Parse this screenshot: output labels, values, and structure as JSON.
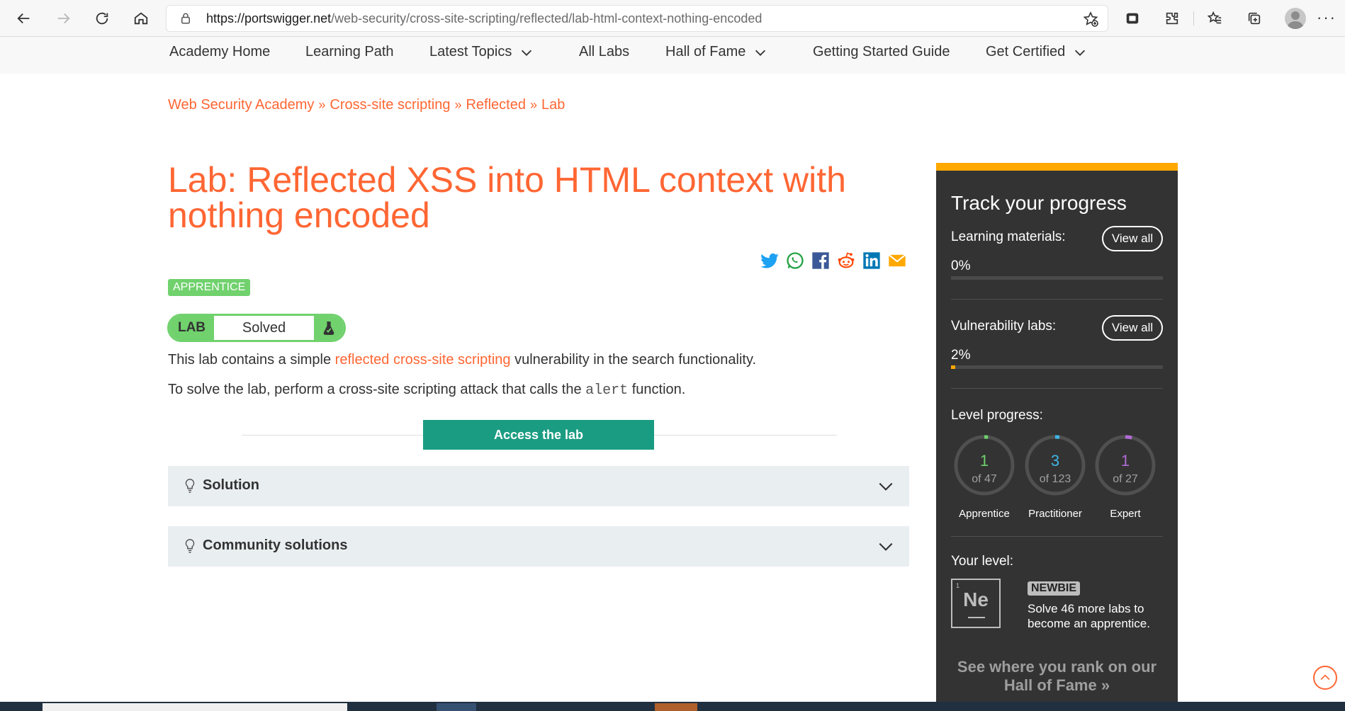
{
  "browser": {
    "url_host": "https://portswigger.net",
    "url_path": "/web-security/cross-site-scripting/reflected/lab-html-context-nothing-encoded",
    "more_label": "···"
  },
  "nav": {
    "items": [
      {
        "label": "Academy Home",
        "dropdown": false
      },
      {
        "label": "Learning Path",
        "dropdown": false
      },
      {
        "label": "Latest Topics",
        "dropdown": true
      },
      {
        "label": "All Labs",
        "dropdown": false
      },
      {
        "label": "Hall of Fame",
        "dropdown": true
      },
      {
        "label": "Getting Started Guide",
        "dropdown": false
      },
      {
        "label": "Get Certified",
        "dropdown": true
      }
    ]
  },
  "breadcrumb": {
    "items": [
      "Web Security Academy",
      "Cross-site scripting",
      "Reflected",
      "Lab"
    ],
    "separator": "»"
  },
  "page": {
    "title": "Lab: Reflected XSS into HTML context with nothing encoded",
    "level_badge": "APPRENTICE",
    "lab_label": "LAB",
    "lab_state": "Solved",
    "para1_pre": "This lab contains a simple ",
    "para1_link": "reflected cross-site scripting",
    "para1_post": " vulnerability in the search functionality.",
    "para2_pre": "To solve the lab, perform a cross-site scripting attack that calls the ",
    "para2_code": "alert",
    "para2_post": " function.",
    "access_button": "Access the lab",
    "accordions": [
      "Solution",
      "Community solutions"
    ],
    "share_icons": [
      "twitter-icon",
      "whatsapp-icon",
      "facebook-icon",
      "reddit-icon",
      "linkedin-icon",
      "email-icon"
    ]
  },
  "sidebar": {
    "title": "Track your progress",
    "learning_label": "Learning materials:",
    "learning_viewall": "View all",
    "learning_pct": "0%",
    "learning_fraction": 0,
    "vuln_label": "Vulnerability labs:",
    "vuln_viewall": "View all",
    "vuln_pct": "2%",
    "vuln_fraction": 0.02,
    "level_progress_label": "Level progress:",
    "levels": [
      {
        "name": "Apprentice",
        "solved": "1",
        "of": "of 47",
        "color": "#70d16d",
        "fraction": 0.021
      },
      {
        "name": "Practitioner",
        "solved": "3",
        "of": "of 123",
        "color": "#3fb6e6",
        "fraction": 0.024
      },
      {
        "name": "Expert",
        "solved": "1",
        "of": "of 27",
        "color": "#b06cd6",
        "fraction": 0.037
      }
    ],
    "your_level_label": "Your level:",
    "element_symbol": "Ne",
    "element_number": "1",
    "level_tag": "NEWBIE",
    "solve_more": "Solve 46 more labs to become an apprentice.",
    "hall_link": "See where you rank on our Hall of Fame »"
  },
  "colors": {
    "accent": "#ff6633",
    "green": "#70d16d",
    "teal": "#1a9c82",
    "sidebar_bg": "#333333",
    "sidebar_border": "#ffa800"
  }
}
